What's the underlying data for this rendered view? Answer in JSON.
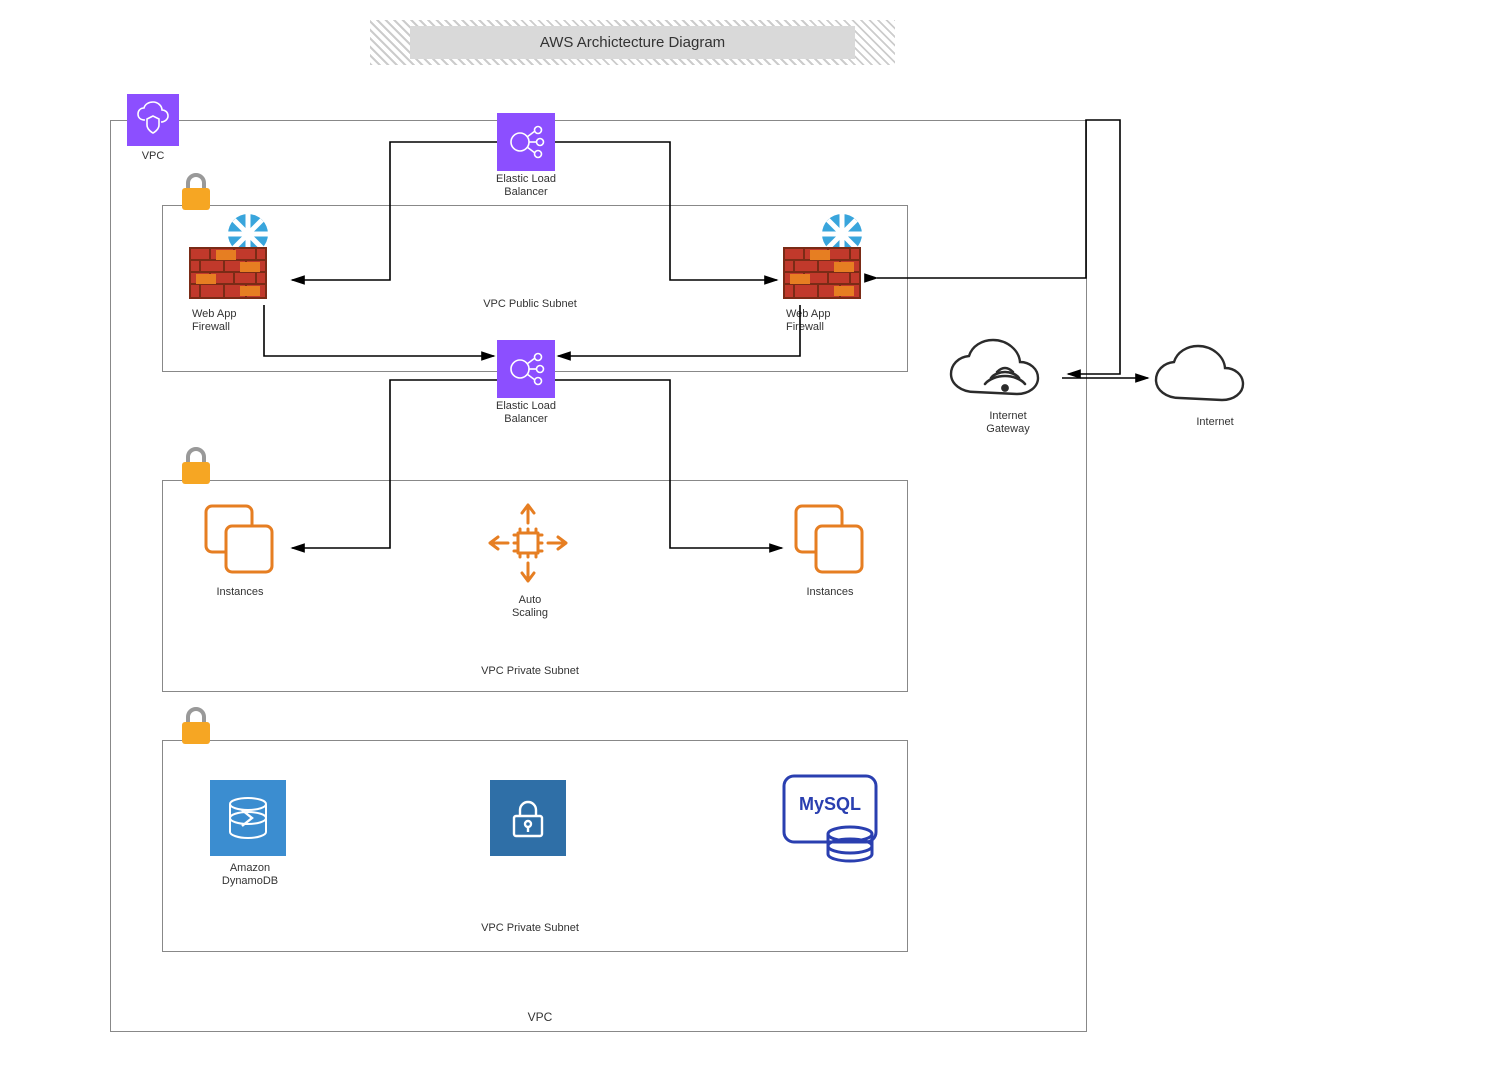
{
  "title": "AWS Archictecture Diagram",
  "vpc": {
    "icon_label": "VPC",
    "bottom_label": "VPC",
    "elb_top": "Elastic Load\nBalancer",
    "elb_mid": "Elastic Load\nBalancer",
    "public_subnet": {
      "label": "VPC Public Subnet",
      "waf_left": "Web App\nFirewall",
      "waf_right": "Web App\nFirewall"
    },
    "private_subnet_1": {
      "label": "VPC Private Subnet",
      "instances_left": "Instances",
      "instances_right": "Instances",
      "autoscaling": "Auto\nScaling"
    },
    "private_subnet_2": {
      "label": "VPC Private Subnet",
      "dynamodb": "Amazon\nDynamoDB",
      "mysql_text": "MySQL"
    }
  },
  "outside": {
    "internet_gateway": "Internet\nGateway",
    "internet": "Internet"
  }
}
